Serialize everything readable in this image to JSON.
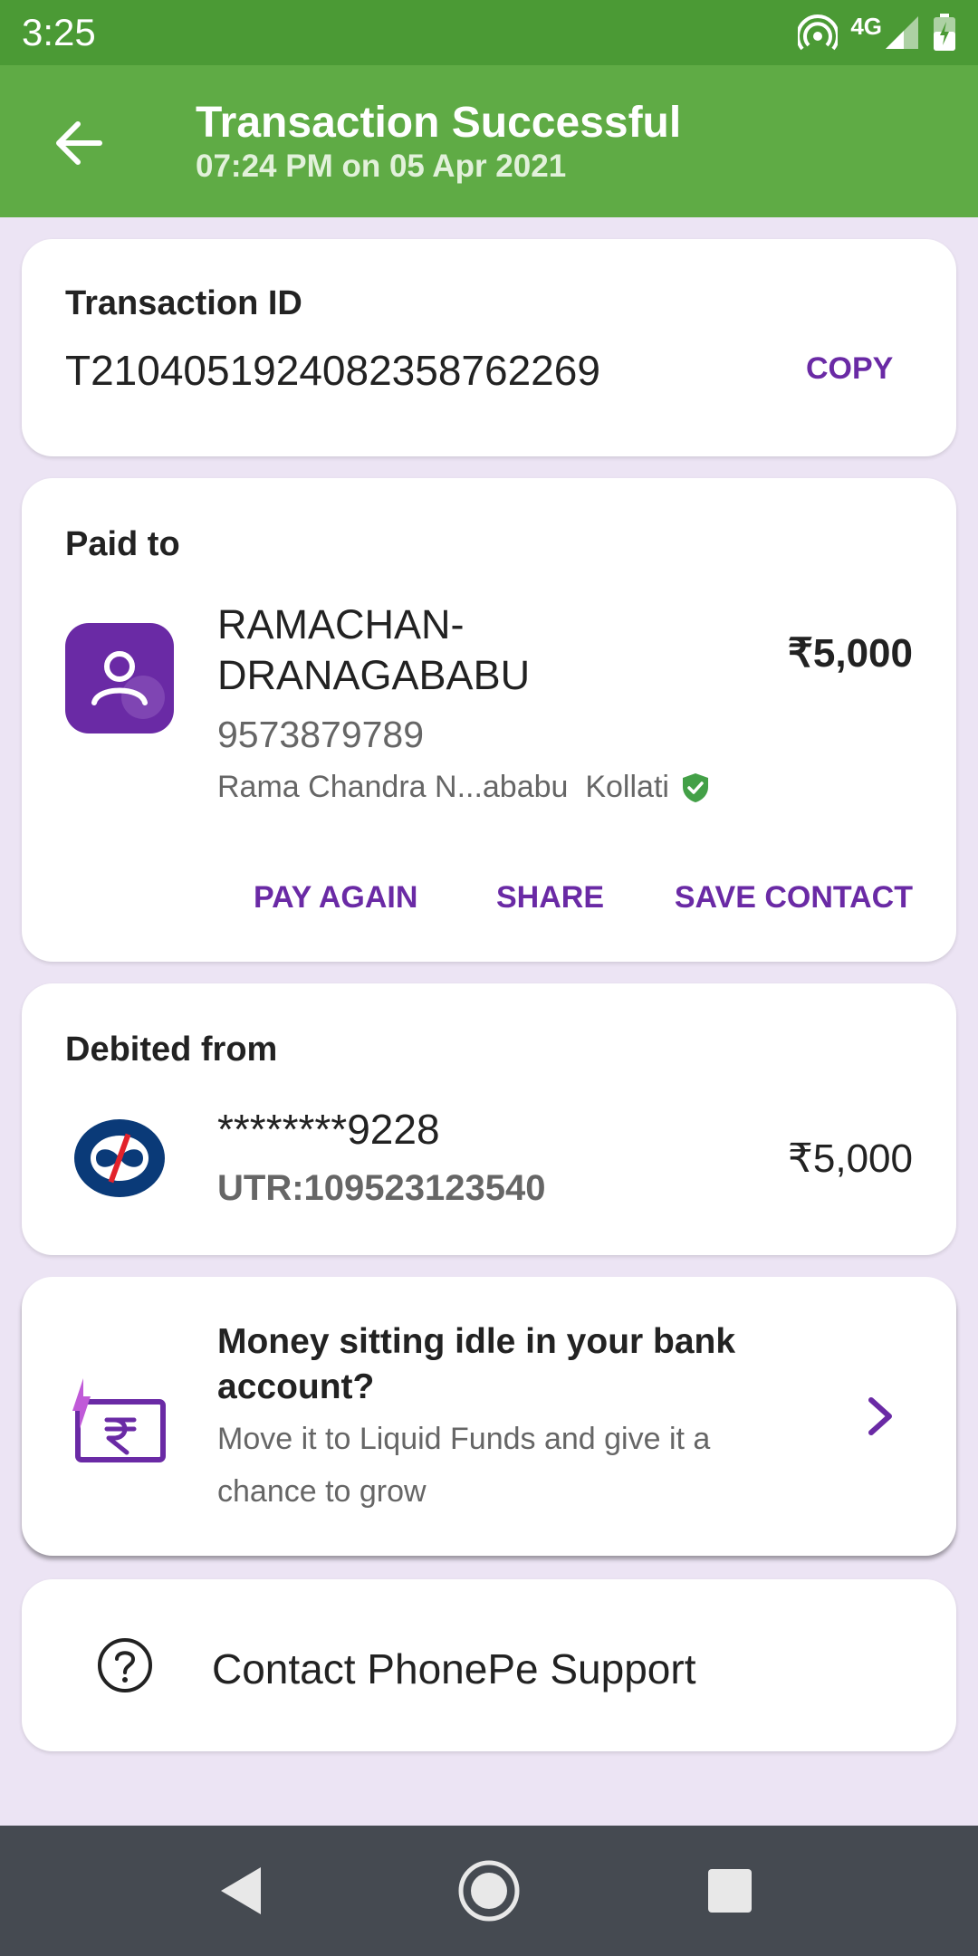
{
  "status_bar": {
    "time": "3:25",
    "network": "4G"
  },
  "header": {
    "title": "Transaction Successful",
    "subtitle": "07:24 PM on 05 Apr 2021"
  },
  "transaction": {
    "label": "Transaction ID",
    "id": "T2104051924082358762269",
    "copy_label": "COPY"
  },
  "paid_to": {
    "label": "Paid to",
    "name_line1": "RAMACHAN-",
    "name_line2": "DRANAGABABU",
    "phone": "9573879789",
    "registered_name": "Rama Chandra N...ababu  Kollati",
    "amount": "₹5,000",
    "actions": {
      "pay_again": "PAY AGAIN",
      "share": "SHARE",
      "save_contact": "SAVE CONTACT"
    }
  },
  "debited_from": {
    "label": "Debited from",
    "account": "********9228",
    "utr": "UTR:109523123540",
    "amount": "₹5,000"
  },
  "promo": {
    "title_line1": "Money sitting idle in your bank",
    "title_line2": "account?",
    "desc_line1": "Move it to Liquid Funds and give it a",
    "desc_line2": "chance to grow"
  },
  "support": {
    "label": "Contact PhonePe Support"
  },
  "colors": {
    "status_bar": "#4b9a35",
    "app_bar": "#5fab45",
    "accent_purple": "#6a2aa5",
    "background": "#ece4f4",
    "verified_green": "#43a047",
    "nav_bar": "#454a51"
  }
}
